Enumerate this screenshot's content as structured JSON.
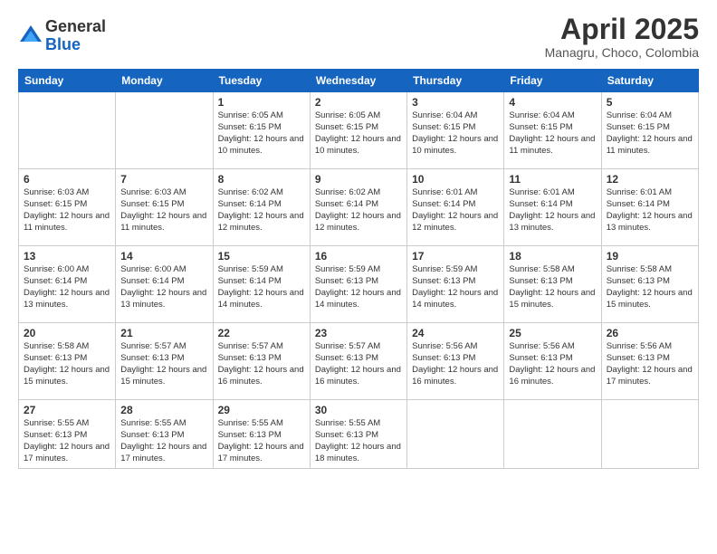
{
  "logo": {
    "general": "General",
    "blue": "Blue"
  },
  "title": "April 2025",
  "location": "Managru, Choco, Colombia",
  "days_of_week": [
    "Sunday",
    "Monday",
    "Tuesday",
    "Wednesday",
    "Thursday",
    "Friday",
    "Saturday"
  ],
  "weeks": [
    [
      {
        "day": "",
        "info": ""
      },
      {
        "day": "",
        "info": ""
      },
      {
        "day": "1",
        "info": "Sunrise: 6:05 AM\nSunset: 6:15 PM\nDaylight: 12 hours and 10 minutes."
      },
      {
        "day": "2",
        "info": "Sunrise: 6:05 AM\nSunset: 6:15 PM\nDaylight: 12 hours and 10 minutes."
      },
      {
        "day": "3",
        "info": "Sunrise: 6:04 AM\nSunset: 6:15 PM\nDaylight: 12 hours and 10 minutes."
      },
      {
        "day": "4",
        "info": "Sunrise: 6:04 AM\nSunset: 6:15 PM\nDaylight: 12 hours and 11 minutes."
      },
      {
        "day": "5",
        "info": "Sunrise: 6:04 AM\nSunset: 6:15 PM\nDaylight: 12 hours and 11 minutes."
      }
    ],
    [
      {
        "day": "6",
        "info": "Sunrise: 6:03 AM\nSunset: 6:15 PM\nDaylight: 12 hours and 11 minutes."
      },
      {
        "day": "7",
        "info": "Sunrise: 6:03 AM\nSunset: 6:15 PM\nDaylight: 12 hours and 11 minutes."
      },
      {
        "day": "8",
        "info": "Sunrise: 6:02 AM\nSunset: 6:14 PM\nDaylight: 12 hours and 12 minutes."
      },
      {
        "day": "9",
        "info": "Sunrise: 6:02 AM\nSunset: 6:14 PM\nDaylight: 12 hours and 12 minutes."
      },
      {
        "day": "10",
        "info": "Sunrise: 6:01 AM\nSunset: 6:14 PM\nDaylight: 12 hours and 12 minutes."
      },
      {
        "day": "11",
        "info": "Sunrise: 6:01 AM\nSunset: 6:14 PM\nDaylight: 12 hours and 13 minutes."
      },
      {
        "day": "12",
        "info": "Sunrise: 6:01 AM\nSunset: 6:14 PM\nDaylight: 12 hours and 13 minutes."
      }
    ],
    [
      {
        "day": "13",
        "info": "Sunrise: 6:00 AM\nSunset: 6:14 PM\nDaylight: 12 hours and 13 minutes."
      },
      {
        "day": "14",
        "info": "Sunrise: 6:00 AM\nSunset: 6:14 PM\nDaylight: 12 hours and 13 minutes."
      },
      {
        "day": "15",
        "info": "Sunrise: 5:59 AM\nSunset: 6:14 PM\nDaylight: 12 hours and 14 minutes."
      },
      {
        "day": "16",
        "info": "Sunrise: 5:59 AM\nSunset: 6:13 PM\nDaylight: 12 hours and 14 minutes."
      },
      {
        "day": "17",
        "info": "Sunrise: 5:59 AM\nSunset: 6:13 PM\nDaylight: 12 hours and 14 minutes."
      },
      {
        "day": "18",
        "info": "Sunrise: 5:58 AM\nSunset: 6:13 PM\nDaylight: 12 hours and 15 minutes."
      },
      {
        "day": "19",
        "info": "Sunrise: 5:58 AM\nSunset: 6:13 PM\nDaylight: 12 hours and 15 minutes."
      }
    ],
    [
      {
        "day": "20",
        "info": "Sunrise: 5:58 AM\nSunset: 6:13 PM\nDaylight: 12 hours and 15 minutes."
      },
      {
        "day": "21",
        "info": "Sunrise: 5:57 AM\nSunset: 6:13 PM\nDaylight: 12 hours and 15 minutes."
      },
      {
        "day": "22",
        "info": "Sunrise: 5:57 AM\nSunset: 6:13 PM\nDaylight: 12 hours and 16 minutes."
      },
      {
        "day": "23",
        "info": "Sunrise: 5:57 AM\nSunset: 6:13 PM\nDaylight: 12 hours and 16 minutes."
      },
      {
        "day": "24",
        "info": "Sunrise: 5:56 AM\nSunset: 6:13 PM\nDaylight: 12 hours and 16 minutes."
      },
      {
        "day": "25",
        "info": "Sunrise: 5:56 AM\nSunset: 6:13 PM\nDaylight: 12 hours and 16 minutes."
      },
      {
        "day": "26",
        "info": "Sunrise: 5:56 AM\nSunset: 6:13 PM\nDaylight: 12 hours and 17 minutes."
      }
    ],
    [
      {
        "day": "27",
        "info": "Sunrise: 5:55 AM\nSunset: 6:13 PM\nDaylight: 12 hours and 17 minutes."
      },
      {
        "day": "28",
        "info": "Sunrise: 5:55 AM\nSunset: 6:13 PM\nDaylight: 12 hours and 17 minutes."
      },
      {
        "day": "29",
        "info": "Sunrise: 5:55 AM\nSunset: 6:13 PM\nDaylight: 12 hours and 17 minutes."
      },
      {
        "day": "30",
        "info": "Sunrise: 5:55 AM\nSunset: 6:13 PM\nDaylight: 12 hours and 18 minutes."
      },
      {
        "day": "",
        "info": ""
      },
      {
        "day": "",
        "info": ""
      },
      {
        "day": "",
        "info": ""
      }
    ]
  ]
}
